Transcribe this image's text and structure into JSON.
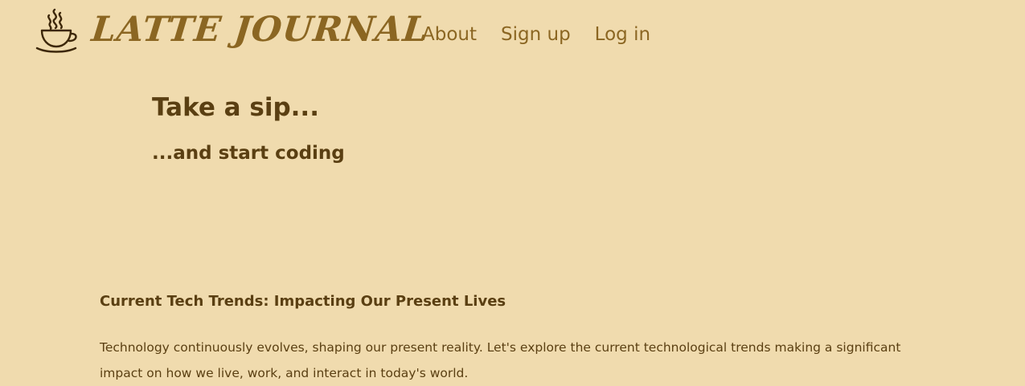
{
  "brand": {
    "title": "LATTE JOURNAL",
    "icon": "coffee-cup-icon"
  },
  "nav": {
    "items": [
      {
        "label": "About"
      },
      {
        "label": "Sign up"
      },
      {
        "label": "Log in"
      }
    ]
  },
  "hero": {
    "title": "Take a sip...",
    "subtitle": "...and start coding"
  },
  "article": {
    "title": "Current Tech Trends: Impacting Our Present Lives",
    "body": "Technology continuously evolves, shaping our present reality. Let's explore the current technological trends making a significant impact on how we live, work, and interact in today's world."
  },
  "colors": {
    "background": "#f0dbae",
    "brand": "#8b6622",
    "text": "#5a3f12"
  }
}
